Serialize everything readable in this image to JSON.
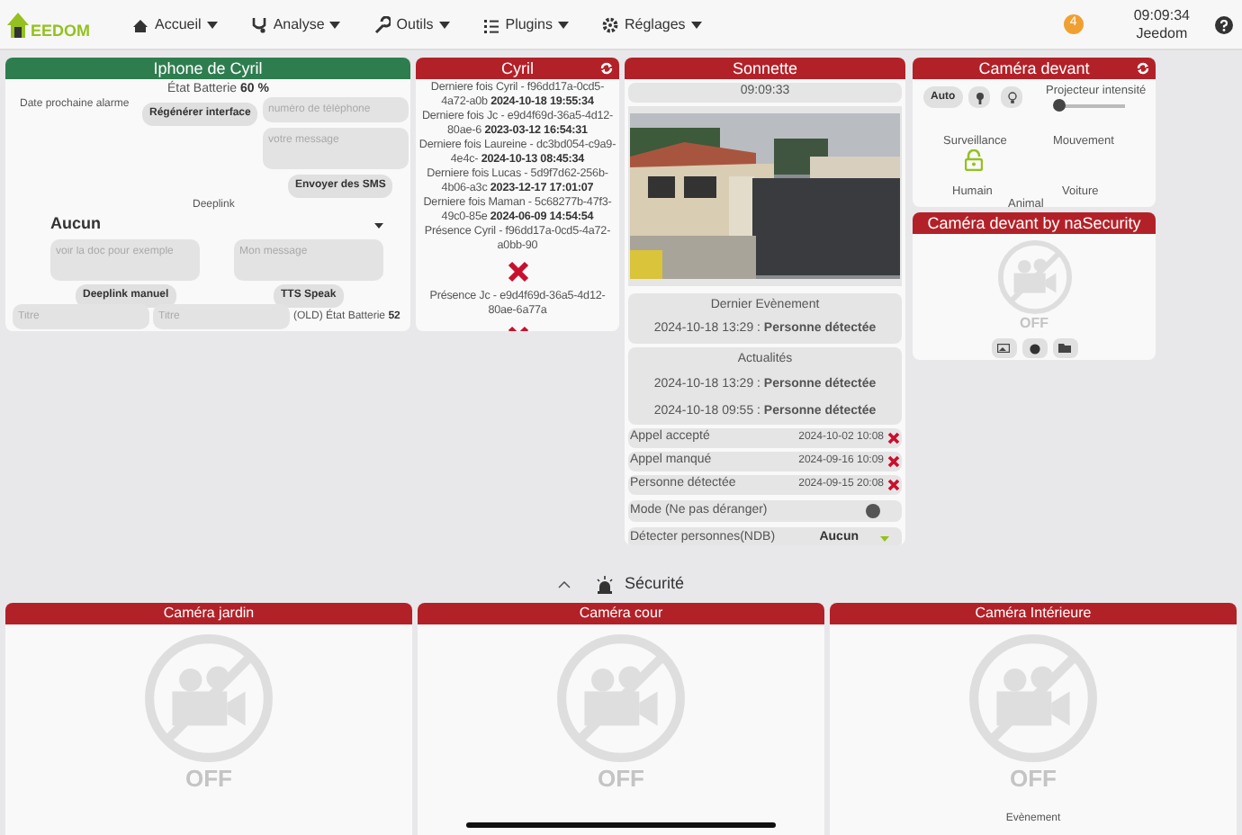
{
  "navbar": {
    "logo_text": "EEDOM",
    "menus": [
      {
        "label": "Accueil"
      },
      {
        "label": "Analyse"
      },
      {
        "label": "Outils"
      },
      {
        "label": "Plugins"
      },
      {
        "label": "Réglages"
      }
    ],
    "notifications": "4",
    "time": "09:09:34",
    "user": "Jeedom"
  },
  "iphone": {
    "title": "Iphone de Cyril",
    "battery_label": "État Batterie",
    "battery_value": "60 %",
    "alarm_label": "Date prochaine alarme",
    "regen_button": "Régénérer interface",
    "phone_placeholder": "numéro de téléphone",
    "message_placeholder": "votre message",
    "sms_button": "Envoyer des SMS",
    "deeplink_label": "Deeplink",
    "deeplink_value": "Aucun",
    "doc_placeholder": "voir la doc pour exemple",
    "tts_placeholder": "Mon message",
    "deeplink_button": "Deeplink manuel",
    "tts_button": "TTS Speak",
    "title_placeholders": [
      "Titre",
      "Titre"
    ],
    "old_battery_label": "(OLD) État Batterie",
    "old_battery_value": "52"
  },
  "cyril": {
    "title": "Cyril",
    "entries": [
      {
        "text": "Derniere fois Cyril - f96dd17a-0cd5-4a72-a0b",
        "date": "2024-10-18 19:55:34"
      },
      {
        "text": "Derniere fois Jc - e9d4f69d-36a5-4d12-80ae-6",
        "date": "2023-03-12 16:54:31"
      },
      {
        "text": "Derniere fois Laureine - dc3bd054-c9a9-4e4c-",
        "date": "2024-10-13 08:45:34"
      },
      {
        "text": "Derniere fois Lucas - 5d9f7d62-256b-4b06-a3c",
        "date": "2023-12-17 17:01:07"
      },
      {
        "text": "Derniere fois Maman - 5c68277b-47f3-49c0-85e",
        "date": "2024-06-09 14:54:54"
      }
    ],
    "presences": [
      {
        "label": "Présence Cyril - f96dd17a-0cd5-4a72-a0bb-90",
        "present": false
      },
      {
        "label": "Présence Jc - e9d4f69d-36a5-4d12-80ae-6a77a",
        "present": false
      }
    ]
  },
  "sonnette": {
    "title": "Sonnette",
    "time": "09:09:33",
    "last_event_label": "Dernier Evènement",
    "last_event": {
      "text": "2024-10-18 13:29 : **Personne détectée**"
    },
    "news_label": "Actualités",
    "news": [
      {
        "text": "2024-10-18 13:29 : **Personne détectée**"
      },
      {
        "text": "2024-10-18 09:55 : **Personne détectée**"
      }
    ],
    "history": [
      {
        "label": "Appel accepté",
        "date": "2024-10-02 10:08"
      },
      {
        "label": "Appel manqué",
        "date": "2024-09-16 10:09"
      },
      {
        "label": "Personne détectée",
        "date": "2024-09-15 20:08"
      }
    ],
    "mode": {
      "label": "Mode (Ne pas déranger)",
      "on": false
    },
    "detect": {
      "label": "Détecter personnes(NDB)",
      "value": "Aucun"
    }
  },
  "camera_devant": {
    "title": "Caméra devant",
    "auto_button": "Auto",
    "slider": {
      "label": "Projecteur intensité",
      "level": 0.05
    },
    "labels": [
      "Surveillance",
      "Mouvement"
    ],
    "labels2": [
      "Humain",
      "Voiture"
    ],
    "animal": "Animal"
  },
  "nasecurity": {
    "title": "Caméra devant by naSecurity",
    "off": "OFF"
  },
  "section": {
    "title": "Sécurité"
  },
  "cameras": [
    {
      "title": "Caméra jardin",
      "off": "OFF"
    },
    {
      "title": "Caméra cour",
      "off": "OFF"
    },
    {
      "title": "Caméra Intérieure",
      "off": "OFF",
      "event": "Evènement"
    }
  ]
}
